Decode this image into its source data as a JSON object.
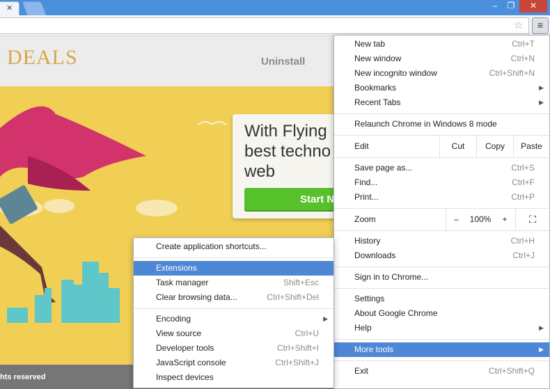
{
  "tabs": {
    "active_close": "✕",
    "new_tab": ""
  },
  "window": {
    "minimize": "–",
    "maximize": "❐",
    "close": "✕"
  },
  "toolbar": {
    "star": "☆",
    "menu": "≡"
  },
  "page": {
    "logo": "DEALS",
    "nav_uninstall": "Uninstall",
    "hero_heading": "With Flying\nbest techno\nweb",
    "hero_cta": "Start Now",
    "footer_text": "hts reserved"
  },
  "menu": {
    "new_tab": {
      "label": "New tab",
      "shortcut": "Ctrl+T"
    },
    "new_window": {
      "label": "New window",
      "shortcut": "Ctrl+N"
    },
    "new_incognito": {
      "label": "New incognito window",
      "shortcut": "Ctrl+Shift+N"
    },
    "bookmarks": {
      "label": "Bookmarks"
    },
    "recent_tabs": {
      "label": "Recent Tabs"
    },
    "relaunch": {
      "label": "Relaunch Chrome in Windows 8 mode"
    },
    "edit": {
      "label": "Edit",
      "cut": "Cut",
      "copy": "Copy",
      "paste": "Paste"
    },
    "save_page": {
      "label": "Save page as...",
      "shortcut": "Ctrl+S"
    },
    "find": {
      "label": "Find...",
      "shortcut": "Ctrl+F"
    },
    "print": {
      "label": "Print...",
      "shortcut": "Ctrl+P"
    },
    "zoom": {
      "label": "Zoom",
      "minus": "–",
      "value": "100%",
      "plus": "+",
      "fullscreen": "⛶"
    },
    "history": {
      "label": "History",
      "shortcut": "Ctrl+H"
    },
    "downloads": {
      "label": "Downloads",
      "shortcut": "Ctrl+J"
    },
    "sign_in": {
      "label": "Sign in to Chrome..."
    },
    "settings": {
      "label": "Settings"
    },
    "about": {
      "label": "About Google Chrome"
    },
    "help": {
      "label": "Help"
    },
    "more_tools": {
      "label": "More tools"
    },
    "exit": {
      "label": "Exit",
      "shortcut": "Ctrl+Shift+Q"
    },
    "arrow": "▶"
  },
  "submenu": {
    "create_shortcuts": {
      "label": "Create application shortcuts..."
    },
    "extensions": {
      "label": "Extensions"
    },
    "task_manager": {
      "label": "Task manager",
      "shortcut": "Shift+Esc"
    },
    "clear_data": {
      "label": "Clear browsing data...",
      "shortcut": "Ctrl+Shift+Del"
    },
    "encoding": {
      "label": "Encoding"
    },
    "view_source": {
      "label": "View source",
      "shortcut": "Ctrl+U"
    },
    "developer_tools": {
      "label": "Developer tools",
      "shortcut": "Ctrl+Shift+I"
    },
    "js_console": {
      "label": "JavaScript console",
      "shortcut": "Ctrl+Shift+J"
    },
    "inspect_devices": {
      "label": "Inspect devices"
    }
  },
  "colors": {
    "titlebar": "#4a8fdc",
    "highlight": "#4d87d6",
    "hero_bg": "#f1cf55",
    "cta_green": "#57c12c"
  }
}
